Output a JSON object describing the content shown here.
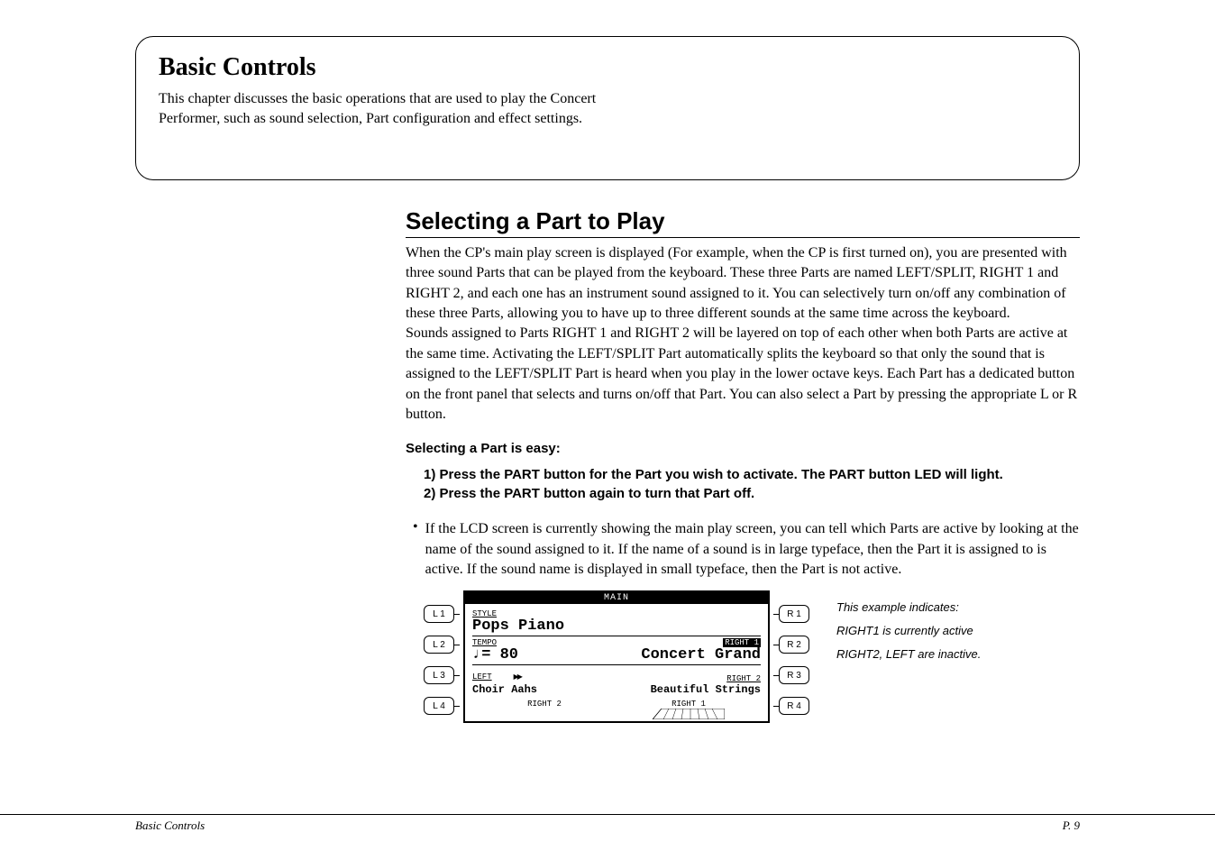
{
  "chapter": {
    "title": "Basic Controls",
    "description": "This chapter discusses the basic operations that are used to play the Concert Performer, such as sound selection, Part configuration and effect settings."
  },
  "section": {
    "title": "Selecting a Part to Play",
    "body_p1": "When the CP's main play screen is displayed (For example, when the CP is first turned on), you are presented with three sound Parts that can be played from the keyboard.  These three Parts are named LEFT/SPLIT, RIGHT 1 and RIGHT 2, and each one has an instrument sound assigned to it.  You can selectively turn on/off any combination of these three Parts, allowing you to have up to three different sounds at the same time across the keyboard.",
    "body_p2": "Sounds assigned to Parts RIGHT 1 and RIGHT 2 will be layered on top of each other when both Parts are active at the same time.  Activating the LEFT/SPLIT Part automatically splits the keyboard so that only the sound that is assigned to the LEFT/SPLIT Part is heard when you play in the lower octave keys.  Each Part has a dedicated button on the front panel that selects and turns on/off that Part.  You can also select a Part by pressing the appropriate L or R button.",
    "subheading": "Selecting a Part is easy:",
    "step1": "1)  Press the PART button for the Part you wish to activate.  The PART button LED will light.",
    "step2": "2)  Press the PART button again to turn that Part off.",
    "bullet": "If the LCD screen is currently showing the main play screen, you can tell which Parts are active by looking at the name of the sound assigned to it.  If the name of a sound is in large typeface, then the Part it is assigned to is active.  If the sound name is displayed in small typeface, then the Part is not active."
  },
  "lcd": {
    "header": "MAIN",
    "left_buttons": [
      "L 1",
      "L 2",
      "L 3",
      "L 4"
    ],
    "right_buttons": [
      "R 1",
      "R 2",
      "R 3",
      "R 4"
    ],
    "row1": {
      "label": "STYLE",
      "value": "Pops Piano"
    },
    "row2": {
      "left_label": "TEMPO",
      "left_value": "♩= 80",
      "right_label": "RIGHT 1",
      "right_value": "Concert Grand"
    },
    "row3": {
      "left_label": "LEFT",
      "left_value": "Choir Aahs",
      "right_label": "RIGHT 2",
      "right_value": "Beautiful Strings"
    },
    "footer": {
      "left": "RIGHT 2",
      "right": "RIGHT 1"
    }
  },
  "caption": {
    "line1": "This example indicates:",
    "line2": "RIGHT1 is currently active",
    "line3": "RIGHT2, LEFT are inactive."
  },
  "footer": {
    "left": "Basic Controls",
    "right": "P. 9"
  }
}
